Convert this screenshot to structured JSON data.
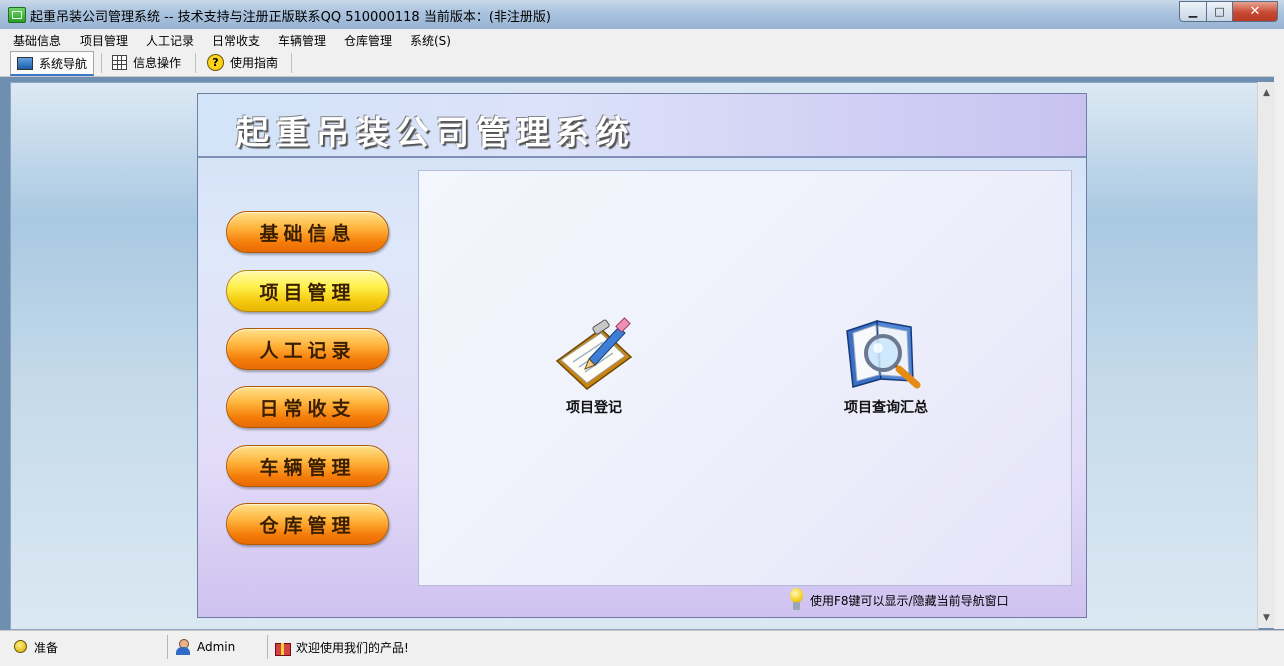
{
  "window": {
    "title": "起重吊装公司管理系统 -- 技术支持与注册正版联系QQ 510000118    当前版本：(非注册版)",
    "minimize_glyph": "▁",
    "maximize_glyph": "□",
    "close_glyph": "✕"
  },
  "menubar": {
    "items": [
      "基础信息",
      "项目管理",
      "人工记录",
      "日常收支",
      "车辆管理",
      "仓库管理",
      "系统(S)"
    ]
  },
  "toolbar": {
    "tabs": [
      {
        "label": "系统导航",
        "icon": "monitor-icon",
        "active": true
      },
      {
        "label": "信息操作",
        "icon": "grid-icon",
        "active": false
      },
      {
        "label": "使用指南",
        "icon": "help-icon",
        "active": false
      }
    ],
    "help_glyph": "?"
  },
  "nav_panel": {
    "title": "起重吊装公司管理系统",
    "buttons": [
      {
        "label": "基础信息",
        "selected": false
      },
      {
        "label": "项目管理",
        "selected": true
      },
      {
        "label": "人工记录",
        "selected": false
      },
      {
        "label": "日常收支",
        "selected": false
      },
      {
        "label": "车辆管理",
        "selected": false
      },
      {
        "label": "仓库管理",
        "selected": false
      }
    ],
    "features": [
      {
        "label": "项目登记",
        "icon": "clipboard-pencil-icon"
      },
      {
        "label": "项目查询汇总",
        "icon": "book-magnifier-icon"
      }
    ],
    "hint": "使用F8键可以显示/隐藏当前导航窗口"
  },
  "scrollbar": {
    "up_glyph": "▲",
    "down_glyph": "▼"
  },
  "statusbar": {
    "status": "准备",
    "user": "Admin",
    "message": "欢迎使用我们的产品!"
  },
  "colors": {
    "nav_button": "#f57e0a",
    "nav_button_selected": "#f5c90f",
    "title_bar": "#a9c2dd",
    "close_button": "#c64a33"
  }
}
